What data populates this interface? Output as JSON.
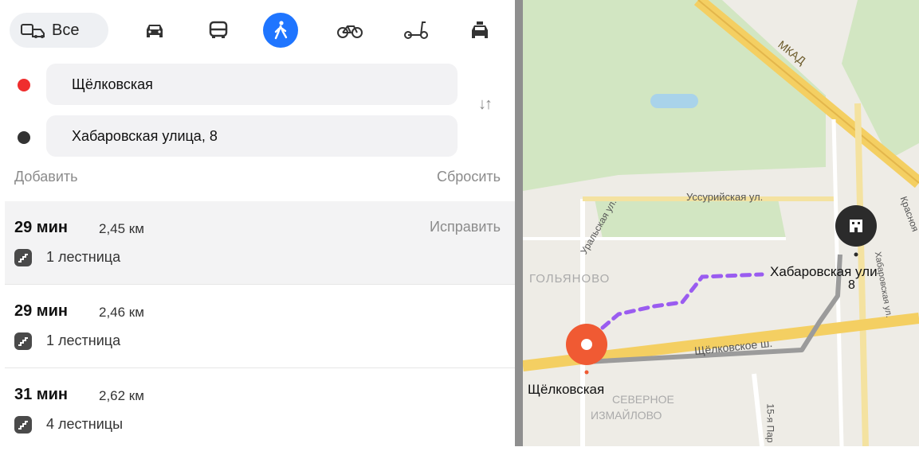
{
  "transport_modes": {
    "all_label": "Все",
    "items": [
      {
        "icon": "car-icon",
        "active": false
      },
      {
        "icon": "bus-icon",
        "active": false
      },
      {
        "icon": "pedestrian-icon",
        "active": true
      },
      {
        "icon": "bicycle-icon",
        "active": false
      },
      {
        "icon": "scooter-icon",
        "active": false
      },
      {
        "icon": "taxi-icon",
        "active": false
      }
    ]
  },
  "route_form": {
    "from": "Щёлковская",
    "to": "Хабаровская улица, 8",
    "add_label": "Добавить",
    "reset_label": "Сбросить"
  },
  "routes": [
    {
      "time": "29 мин",
      "distance": "2,45 км",
      "stairs": "1 лестница",
      "fix_label": "Исправить",
      "selected": true
    },
    {
      "time": "29 мин",
      "distance": "2,46 км",
      "stairs": "1 лестница",
      "selected": false
    },
    {
      "time": "31 мин",
      "distance": "2,62 км",
      "stairs": "4 лестницы",
      "selected": false
    }
  ],
  "map": {
    "labels": {
      "mkad": "МКАД",
      "ussuriyskaya": "Уссурийская ул.",
      "uralskaya": "Уральская ул.",
      "krasnoyarskaya": "Красноя",
      "golyanovo": "ГОЛЬЯНОВО",
      "destination_line1": "Хабаровская ули",
      "destination_line2": "8",
      "shchelkovskoe": "Щёлковское ш.",
      "origin": "Щёлковская",
      "severnoe1": "СЕВЕРНОЕ",
      "severnoe2": "ИЗМАЙЛОВО",
      "parkovaya": "15-я Пар",
      "khabarovskaya_street": "Хабаровская ул."
    },
    "colors": {
      "route_walk": "#9a5cf0",
      "route_gray": "#9b9b9b",
      "origin_pin": "#f05a33",
      "dest_pin": "#2b2b2b",
      "road_yellow": "#f4cf62",
      "park": "#cfe5bf"
    }
  }
}
